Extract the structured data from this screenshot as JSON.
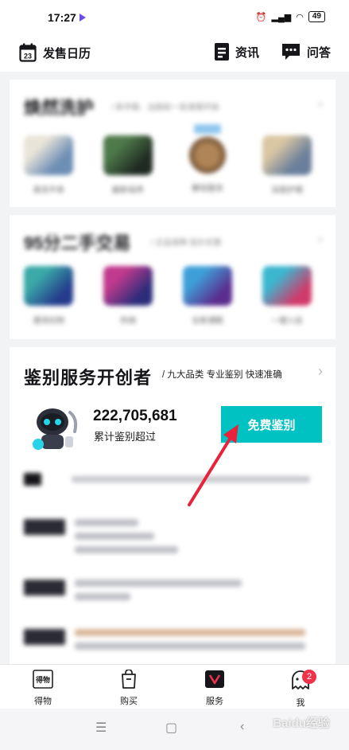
{
  "status_bar": {
    "time": "17:27",
    "battery": "49"
  },
  "top_nav": {
    "calendar_day": "23",
    "release_calendar": "发售日历",
    "news": "资讯",
    "qa": "问答"
  },
  "section_care": {
    "title": "焕然洗护",
    "subtitle": "/ 新手鞋、出趟前一些清理开始",
    "products": [
      {
        "label": "清洗平券"
      },
      {
        "label": "翻新保养"
      },
      {
        "label": "攀现服务"
      },
      {
        "label": "深度护理"
      }
    ]
  },
  "section_secondhand": {
    "title": "95分二手交易",
    "subtitle": "/ 正品保障 低价优惠",
    "products": [
      {
        "label": "潮流玩物"
      },
      {
        "label": "热销"
      },
      {
        "label": "全新潮鞋"
      },
      {
        "label": "一键入驻"
      }
    ]
  },
  "section_auth": {
    "title": "鉴别服务开创者",
    "subtitle": "/  九大品类 专业鉴别 快速准确",
    "count": "222,705,681",
    "count_label": "累计鉴别超过",
    "button": "免费鉴别"
  },
  "tabbar": {
    "items": [
      {
        "label": "得物",
        "icon_text": "得物"
      },
      {
        "label": "购买"
      },
      {
        "label": "服务"
      },
      {
        "label": "我"
      }
    ],
    "badge": "2"
  },
  "watermark": "Baidu经验",
  "colors": {
    "accent": "#01c2c3",
    "arrow": "#e8223b",
    "badge": "#f0334b"
  }
}
